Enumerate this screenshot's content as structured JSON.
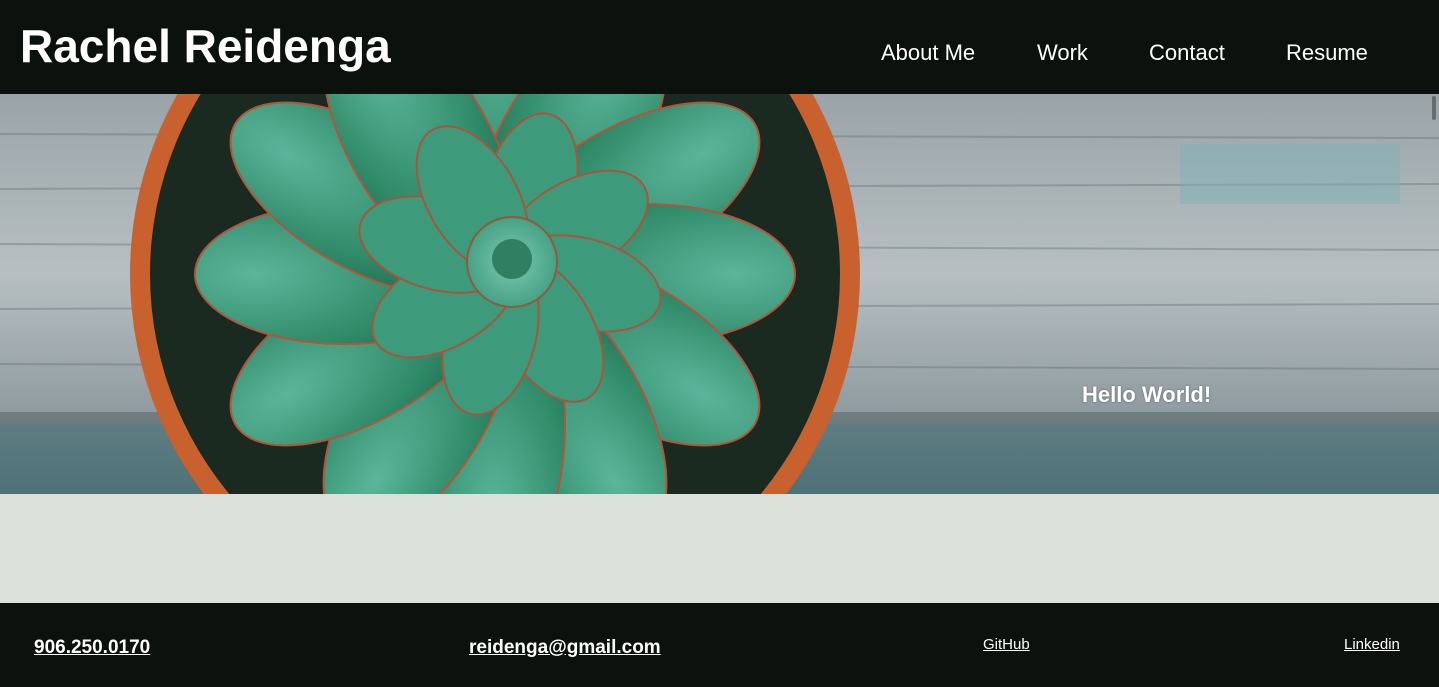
{
  "header": {
    "title": "Rachel Reidenga",
    "nav": [
      {
        "label": "About Me"
      },
      {
        "label": "Work"
      },
      {
        "label": "Contact"
      },
      {
        "label": "Resume"
      }
    ]
  },
  "hero": {
    "heading": "Hello World!",
    "image_subject": "succulent-in-terracotta-pot-on-weathered-wood"
  },
  "footer": {
    "phone": "906.250.0170",
    "email": "reidenga@gmail.com",
    "github": "GitHub",
    "linkedin": "Linkedin"
  },
  "colors": {
    "header_bg": "#0b110c",
    "page_bg": "#dbe0da",
    "text": "#ffffff"
  }
}
